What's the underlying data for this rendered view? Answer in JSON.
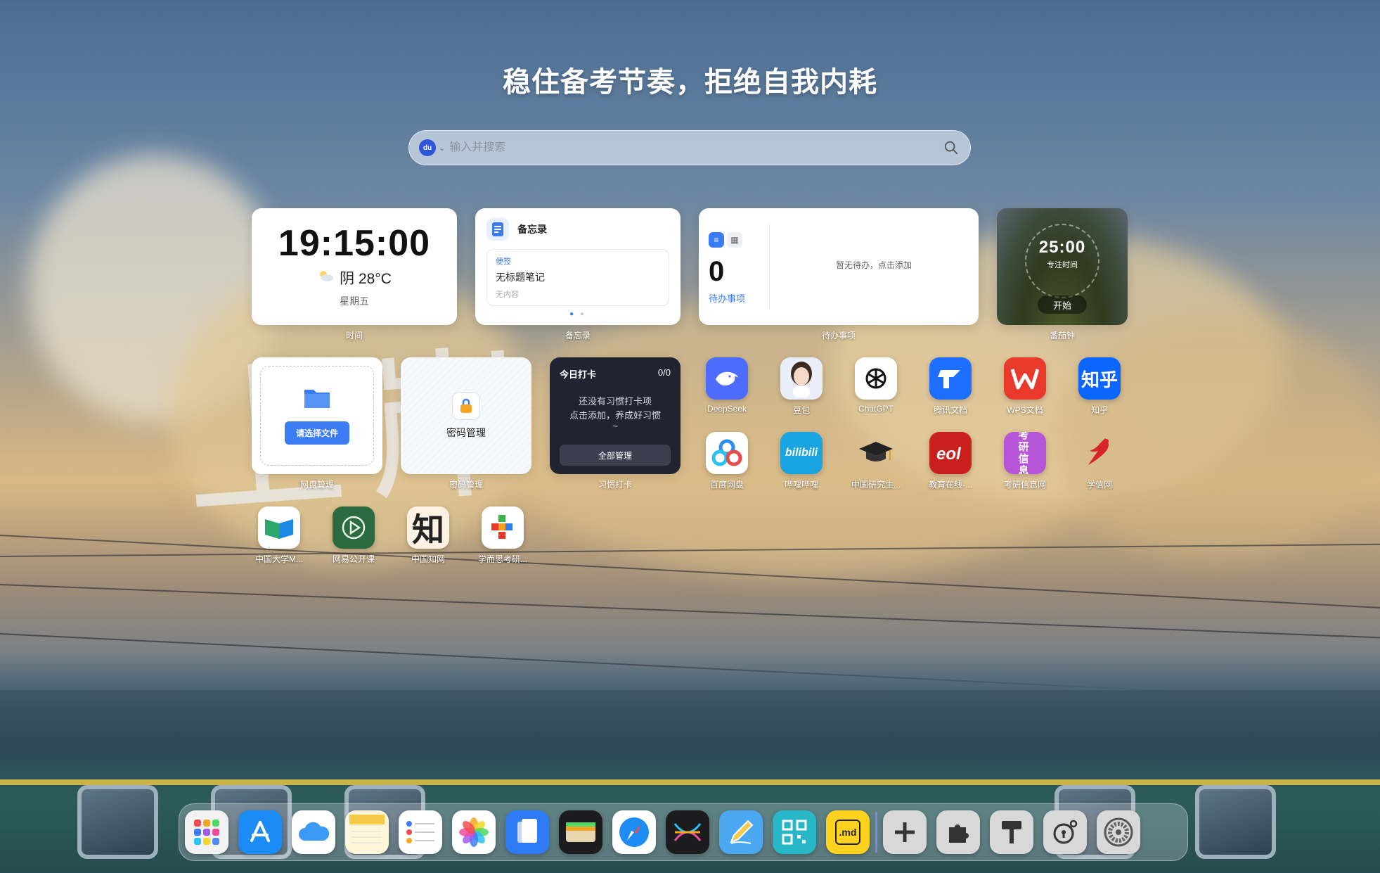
{
  "header": {
    "slogan": "稳住备考节奏，拒绝自我内耗"
  },
  "search": {
    "engine_badge": "du",
    "placeholder": "输入并搜索"
  },
  "widgets": {
    "time": {
      "clock": "19:15:00",
      "weather": "阴 28°C",
      "weekday": "星期五",
      "label": "时间"
    },
    "memo": {
      "header": "备忘录",
      "tag": "便签",
      "note_title": "无标题笔记",
      "note_body": "无内容",
      "label": "备忘录"
    },
    "todo": {
      "count": "0",
      "count_label": "待办事项",
      "empty_text": "暂无待办，点击添加",
      "label": "待办事项"
    },
    "pomodoro": {
      "time": "25:00",
      "caption": "专注时间",
      "start": "开始",
      "label": "番茄钟"
    },
    "disk": {
      "button": "请选择文件",
      "label": "网盘管理"
    },
    "password": {
      "title": "密码管理",
      "label": "密码管理"
    },
    "habit": {
      "title": "今日打卡",
      "progress": "0/0",
      "message_line1": "还没有习惯打卡项",
      "message_line2": "点击添加，养成好习惯",
      "message_line3": "~",
      "all_button": "全部管理",
      "label": "习惯打卡"
    }
  },
  "apps": [
    {
      "name": "DeepSeek",
      "icon": "deepseek-whale",
      "color": "#4d6bfe"
    },
    {
      "name": "豆包",
      "icon": "doubao-avatar",
      "color": "#e9eef8"
    },
    {
      "name": "ChatGPT",
      "icon": "openai-knot",
      "color": "#ffffff"
    },
    {
      "name": "腾讯文档",
      "icon": "tencent-docs",
      "color": "#1e6fff"
    },
    {
      "name": "WPS文档",
      "icon": "wps-w",
      "color": "#e8392b"
    },
    {
      "name": "知乎",
      "icon": "zhihu",
      "color": "#0a66ff",
      "glyph": "知乎"
    },
    {
      "name": "百度网盘",
      "icon": "baidu-netdisk",
      "color": "#ffffff"
    },
    {
      "name": "哔哩哔哩",
      "icon": "bilibili",
      "color": "#1aa4e0",
      "glyph": "bilibili"
    },
    {
      "name": "中国研究生...",
      "icon": "graduation-cap",
      "color": "transparent"
    },
    {
      "name": "教育在线-...",
      "icon": "eol",
      "color": "#c8201c"
    },
    {
      "name": "考研信息网",
      "icon": "kaoyan-info",
      "color": "#b655d8",
      "glyph": "考研信息"
    },
    {
      "name": "学信网",
      "icon": "chsi-bird",
      "color": "transparent"
    },
    {
      "name": "中国大学M...",
      "icon": "icourse-book",
      "color": "#ffffff"
    },
    {
      "name": "网易公开课",
      "icon": "play-triangle",
      "color": "#2b6b3f"
    },
    {
      "name": "中国知网",
      "icon": "cnki",
      "color": "#fdf1e3",
      "glyph": "知"
    },
    {
      "name": "学而思考研...",
      "icon": "xueersi-blocks",
      "color": "#ffffff"
    }
  ],
  "dock": [
    {
      "name": "launchpad",
      "color": "#f2f2f2"
    },
    {
      "name": "app-store",
      "color": "#1b8cf5"
    },
    {
      "name": "icloud",
      "color": "#ffffff"
    },
    {
      "name": "notes",
      "color": "#fdf6d9"
    },
    {
      "name": "reminders",
      "color": "#ffffff"
    },
    {
      "name": "photos",
      "color": "#ffffff"
    },
    {
      "name": "files",
      "color": "#2f7bf5"
    },
    {
      "name": "wallet",
      "color": "#1c1c1e"
    },
    {
      "name": "safari",
      "color": "#ffffff"
    },
    {
      "name": "perplexity",
      "color": "#1c1c1e"
    },
    {
      "name": "freeform",
      "color": "#4aa7f0"
    },
    {
      "name": "qr-code",
      "color": "#27b7c6"
    },
    {
      "name": "markdown",
      "color": "#ffd21f"
    },
    {
      "name": "add",
      "color": "#d8d8d8"
    },
    {
      "name": "extensions",
      "color": "#d8d8d8"
    },
    {
      "name": "brush",
      "color": "#d8d8d8"
    },
    {
      "name": "lock-settings",
      "color": "#d8d8d8"
    },
    {
      "name": "system-settings",
      "color": "#d8d8d8"
    }
  ],
  "dock_labels": {
    "markdown": ".md"
  }
}
